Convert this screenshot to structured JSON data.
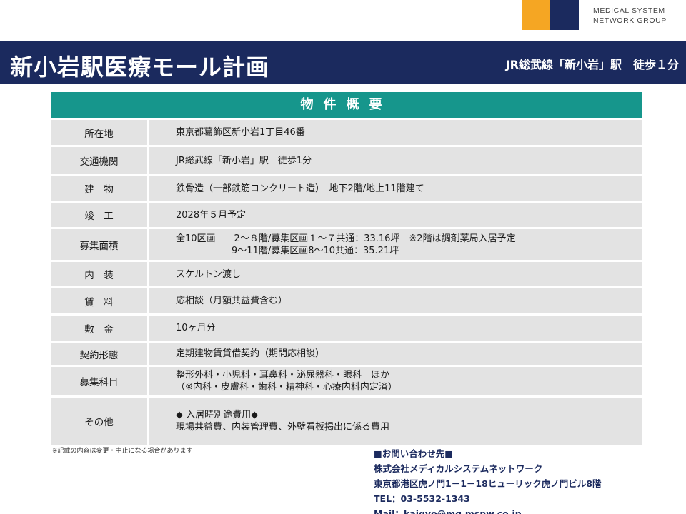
{
  "company": {
    "logo_colors": {
      "left": "#f5a623",
      "right": "#1b2a5e"
    },
    "name_line1": "MEDICAL SYSTEM",
    "name_line2": "NETWORK GROUP"
  },
  "header": {
    "title": "新小岩駅医療モール計画",
    "access": "JR総武線「新小岩」駅　徒歩１分",
    "bar_color": "#1b2a5e"
  },
  "table": {
    "heading": "物件概要",
    "heading_color": "#16968c",
    "rows": [
      {
        "label": "所在地",
        "lines": [
          "東京都葛飾区新小岩1丁目46番"
        ]
      },
      {
        "label": "交通機関",
        "lines": [
          "JR総武線「新小岩」駅　徒歩1分"
        ]
      },
      {
        "label": "建　物",
        "lines": [
          "鉄骨造（一部鉄筋コンクリート造）　地下2階/地上11階建て"
        ]
      },
      {
        "label": "竣　工",
        "lines": [
          "2028年５月予定"
        ]
      },
      {
        "label": "募集面積",
        "lines": [
          "全10区画　　2～８階/募集区画１～７共通：33.16坪　※2階は調剤薬局入居予定",
          "　　　　　　9～11階/募集区画8～10共通：35.21坪"
        ]
      },
      {
        "label": "内　装",
        "lines": [
          "スケルトン渡し"
        ]
      },
      {
        "label": "賃　料",
        "lines": [
          "応相談（月額共益費含む）"
        ]
      },
      {
        "label": "敷　金",
        "lines": [
          "10ヶ月分"
        ]
      },
      {
        "label": "契約形態",
        "lines": [
          "定期建物賃貸借契約（期間応相談）"
        ]
      },
      {
        "label": "募集科目",
        "lines": [
          "整形外科・小児科・耳鼻科・泌尿器科・眼科　ほか",
          "（※内科・皮膚科・歯科・精神科・心療内科内定済）"
        ]
      },
      {
        "label": "その他",
        "lines": [
          "◆ 入居時別途費用◆",
          "現場共益費、内装管理費、外壁看板掲出に係る費用"
        ]
      }
    ]
  },
  "footnote": "※記載の内容は変更・中止になる場合があります",
  "contact": {
    "heading": "■お問い合わせ先■",
    "company": "株式会社メディカルシステムネットワーク",
    "address": "東京都港区虎ノ門1－1－18ヒューリック虎ノ門ビル8階",
    "tel": "TEL：03-5532-1343",
    "mail": "Mail：kaigyo@mg.msnw.co.jp"
  }
}
